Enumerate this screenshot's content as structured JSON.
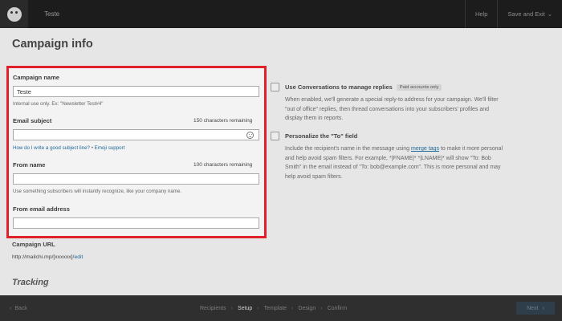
{
  "topbar": {
    "campaign_name": "Teste",
    "help_label": "Help",
    "save_exit_label": "Save and Exit",
    "save_exit_chevron": "⌄"
  },
  "page": {
    "title": "Campaign info"
  },
  "form": {
    "campaign_name_label": "Campaign name",
    "campaign_name_value": "Teste",
    "campaign_name_help": "Internal use only. Ex: \"Newsletter Test#4\"",
    "email_subject_label": "Email subject",
    "email_subject_counter": "150 characters remaining",
    "email_subject_value": "",
    "subject_help_link": "How do I write a good subject line?",
    "subject_help_sep": " • ",
    "emoji_support_link": "Emoji support",
    "from_name_label": "From name",
    "from_name_counter": "100 characters remaining",
    "from_name_value": "",
    "from_name_help": "Use something subscribers will instantly recognize, like your company name.",
    "from_email_label": "From email address",
    "from_email_value": ""
  },
  "campaign_url": {
    "label": "Campaign URL",
    "prefix": "http://mailchi.mp/[xxxxxx]/",
    "edit_link": "edit"
  },
  "tracking": {
    "title": "Tracking"
  },
  "options": {
    "conversations": {
      "title": "Use Conversations to manage replies",
      "badge": "Paid accounts only",
      "line1": "When enabled, we'll generate a special reply-to address for your campaign. We'll filter",
      "line2": "\"out of office\" replies, then thread conversations into your subscribers' profiles and",
      "line3": "display them in reports."
    },
    "personalize": {
      "title": "Personalize the \"To\" field",
      "line1a": "Include the recipient's name in the message using ",
      "merge_tags_link": "merge tags",
      "line1b": " to make it more personal",
      "line2": "and help avoid spam filters. For example, *|FNAME|* *|LNAME|* will show \"To: Bob",
      "line3": "Smith\" in the email instead of \"To: bob@example.com\". This is more personal and may",
      "line4": "help avoid spam filters."
    }
  },
  "bottombar": {
    "back_chevron": "‹",
    "back_label": "Back",
    "steps": [
      "Recipients",
      "Setup",
      "Template",
      "Design",
      "Confirm"
    ],
    "step_chevron": "›",
    "active_step": "Setup",
    "next_label": "Next",
    "next_chevron": "›"
  },
  "colors": {
    "highlight_border": "#e0212b",
    "link": "#216a99",
    "topbar_bg": "#1c1c1c",
    "bottombar_bg": "#2f2f2f"
  }
}
